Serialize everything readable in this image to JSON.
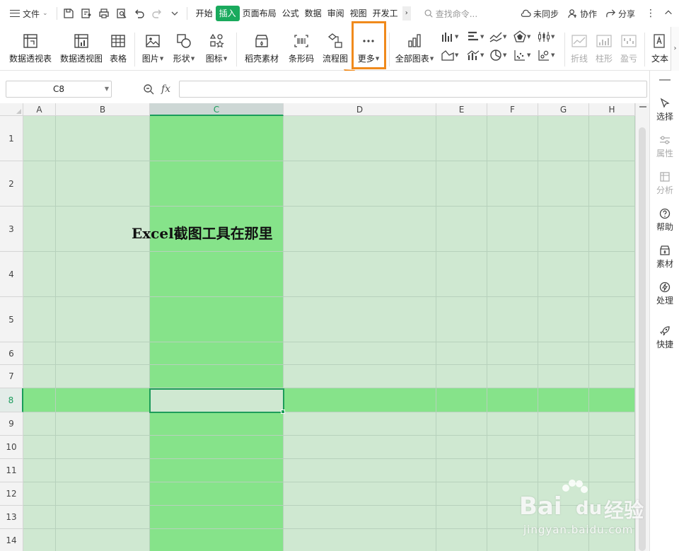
{
  "menubar": {
    "file_label": "文件",
    "tabs": [
      {
        "label": "开始"
      },
      {
        "label": "插入",
        "active": true
      },
      {
        "label": "页面布局"
      },
      {
        "label": "公式"
      },
      {
        "label": "数据"
      },
      {
        "label": "审阅"
      },
      {
        "label": "视图"
      },
      {
        "label": "开发工"
      }
    ],
    "search_placeholder": "查找命令...",
    "sync_label": "未同步",
    "collab_label": "协作",
    "share_label": "分享"
  },
  "ribbon": {
    "pivot_table": "数据透视表",
    "pivot_chart": "数据透视图",
    "table": "表格",
    "picture": "图片",
    "shape": "形状",
    "icon": "图标",
    "material": "稻壳素材",
    "barcode": "条形码",
    "flowchart": "流程图",
    "more": "更多",
    "all_charts": "全部图表",
    "sparkline_line": "折线",
    "sparkline_column": "柱形",
    "sparkline_winloss": "盈亏",
    "text": "文本"
  },
  "formula_bar": {
    "cell_ref": "C8",
    "fx_label": "fx",
    "formula_value": ""
  },
  "sheet": {
    "columns": [
      "A",
      "B",
      "C",
      "D",
      "E",
      "F",
      "G",
      "H"
    ],
    "rows": [
      "1",
      "2",
      "3",
      "4",
      "5",
      "6",
      "7",
      "8",
      "9",
      "10",
      "11",
      "12",
      "13",
      "14"
    ],
    "selected_column": "C",
    "selected_row": "8",
    "cell_text": "Excel截图工具在那里",
    "cell_text_address": "C3"
  },
  "side_panel": {
    "items": [
      {
        "label": "选择",
        "icon": "cursor-icon",
        "enabled": true
      },
      {
        "label": "属性",
        "icon": "properties-icon",
        "enabled": false
      },
      {
        "label": "分析",
        "icon": "analysis-icon",
        "enabled": false
      },
      {
        "label": "帮助",
        "icon": "help-icon",
        "enabled": true
      },
      {
        "label": "素材",
        "icon": "material-icon",
        "enabled": true
      },
      {
        "label": "处理",
        "icon": "process-icon",
        "enabled": true
      },
      {
        "label": "快捷",
        "icon": "rocket-icon",
        "enabled": true
      }
    ]
  },
  "colors": {
    "accent": "#1aaa5d",
    "highlight_box": "#f08a1c",
    "sheet_bg": "#cfe8d1",
    "selection_band": "#86e38a"
  },
  "watermark": {
    "brand": "Bai",
    "brand_suffix": "du",
    "product": "经验",
    "url": "jingyan.baidu.com"
  }
}
